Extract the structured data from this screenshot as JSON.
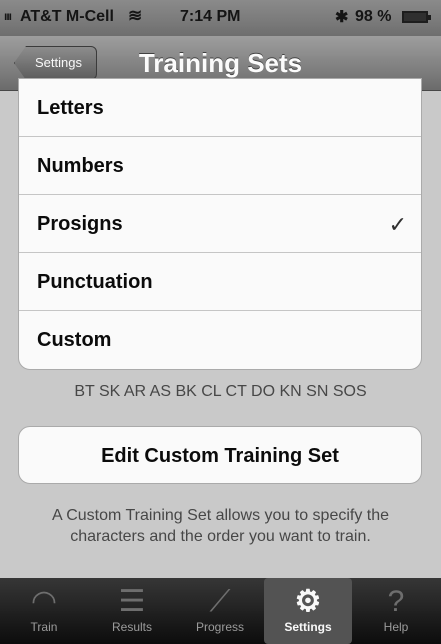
{
  "status_bar": {
    "signal": "ııı",
    "carrier": "AT&T M-Cell",
    "time": "7:14 PM",
    "bluetooth": "✱",
    "battery": "98 %"
  },
  "nav": {
    "back_label": "Settings",
    "title": "Training Sets"
  },
  "training_sets": [
    {
      "label": "Letters",
      "checked": false
    },
    {
      "label": "Numbers",
      "checked": false
    },
    {
      "label": "Prosigns",
      "checked": true
    },
    {
      "label": "Punctuation",
      "checked": false
    },
    {
      "label": "Custom",
      "checked": false
    }
  ],
  "checkmark": "✓",
  "prosign_list": "BT SK AR AS BK CL CT DO KN SN SOS",
  "edit_button": "Edit Custom Training Set",
  "help_text": "A Custom Training Set allows you to specify the characters and the order you want to train.",
  "tab_bar": {
    "tabs": [
      {
        "label": "Train",
        "icon": "headphones-icon",
        "active": false
      },
      {
        "label": "Results",
        "icon": "list-icon",
        "active": false
      },
      {
        "label": "Progress",
        "icon": "chart-icon",
        "active": false
      },
      {
        "label": "Settings",
        "icon": "gears-icon",
        "active": true
      },
      {
        "label": "Help",
        "icon": "question-icon",
        "active": false
      }
    ]
  }
}
